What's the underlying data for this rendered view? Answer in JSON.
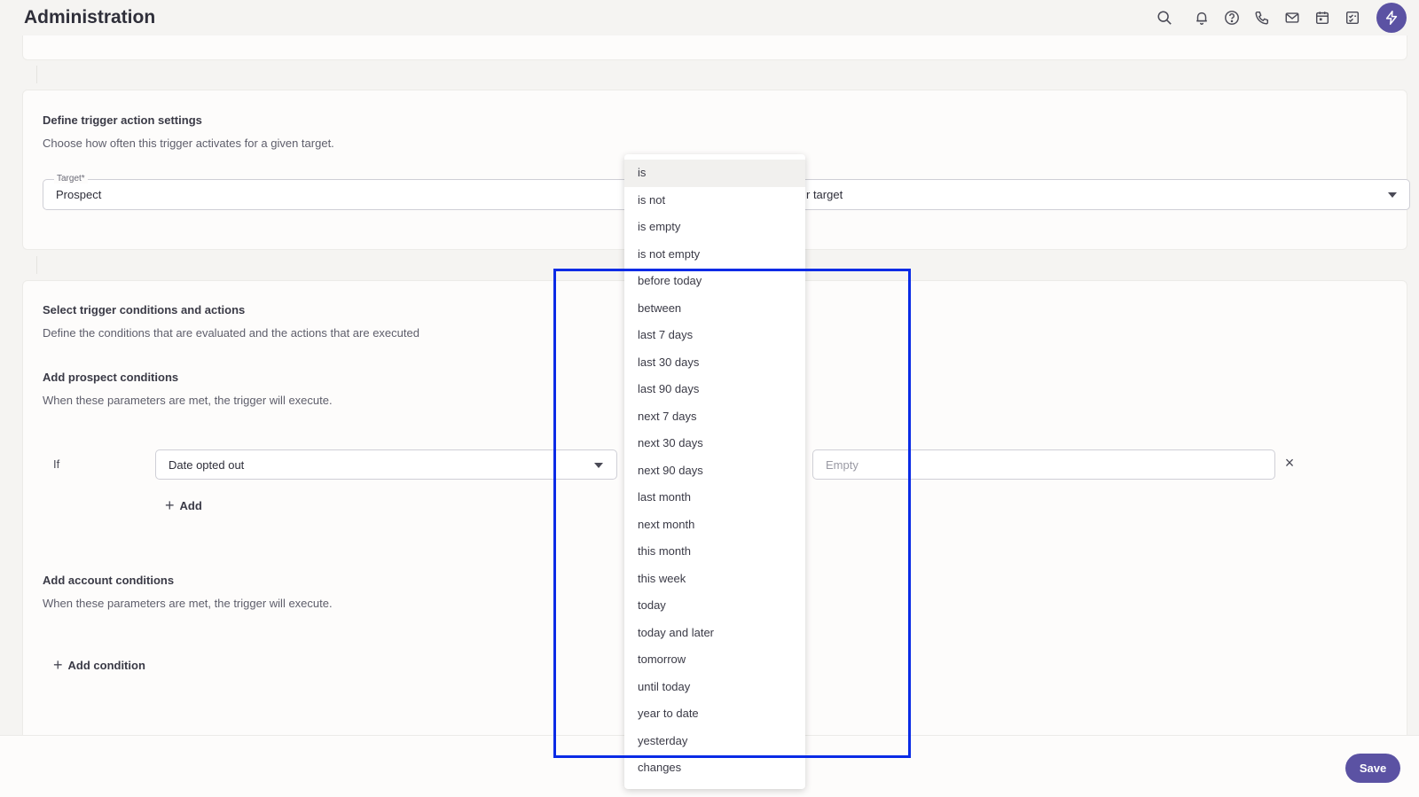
{
  "header": {
    "title": "Administration",
    "icons": [
      "search-icon",
      "bell-icon",
      "help-icon",
      "phone-icon",
      "mail-icon",
      "calendar-icon",
      "tasks-icon",
      "bolt-icon"
    ]
  },
  "trigger_settings": {
    "title": "Define trigger action settings",
    "subtitle": "Choose how often this trigger activates for a given target.",
    "target_label": "Target*",
    "target_value": "Prospect",
    "frequency_partial": "r target"
  },
  "conditions": {
    "title": "Select trigger conditions and actions",
    "subtitle": "Define the conditions that are evaluated and the actions that are executed",
    "prospect": {
      "title": "Add prospect conditions",
      "subtitle": "When these parameters are met, the trigger will execute.",
      "if_label": "If",
      "field_value": "Date opted out",
      "value_placeholder": "Empty",
      "add_label": "Add"
    },
    "account": {
      "title": "Add account conditions",
      "subtitle": "When these parameters are met, the trigger will execute.",
      "add_condition_label": "Add condition"
    }
  },
  "operator_dropdown": {
    "selected": "is",
    "options": [
      "is",
      "is not",
      "is empty",
      "is not empty",
      "before today",
      "between",
      "last 7 days",
      "last 30 days",
      "last 90 days",
      "next 7 days",
      "next 30 days",
      "next 90 days",
      "last month",
      "next month",
      "this month",
      "this week",
      "today",
      "today and later",
      "tomorrow",
      "until today",
      "year to date",
      "yesterday",
      "changes"
    ]
  },
  "footer": {
    "save_label": "Save"
  },
  "colors": {
    "accent": "#5b52a3",
    "highlight": "#0a2be6"
  }
}
